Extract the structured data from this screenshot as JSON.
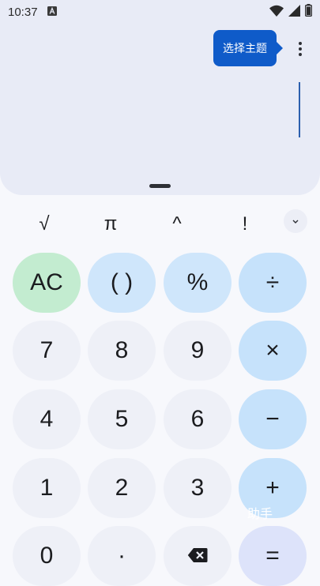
{
  "status_bar": {
    "time": "10:37",
    "notification_icon": "a-square-icon",
    "icons": [
      "wifi-icon",
      "signal-icon",
      "battery-icon"
    ]
  },
  "display": {
    "tooltip": "选择主题",
    "menu_icon": "more-vert-icon"
  },
  "scientific_row": {
    "keys": [
      "√",
      "π",
      "^",
      "!"
    ],
    "expand_icon": "chevron-down-icon"
  },
  "keypad": {
    "ac": "AC",
    "parens": "( )",
    "percent": "%",
    "divide": "÷",
    "seven": "7",
    "eight": "8",
    "nine": "9",
    "multiply": "×",
    "four": "4",
    "five": "5",
    "six": "6",
    "minus": "−",
    "one": "1",
    "two": "2",
    "three": "3",
    "plus": "+",
    "zero": "0",
    "decimal": "·",
    "backspace_icon": "backspace-icon",
    "equals": "="
  },
  "watermark": "助手",
  "colors": {
    "accent": "#0f5bc9",
    "ac_key": "#c3ecd0",
    "operator_key": "#c6e2fb",
    "digit_key": "#eef0f7",
    "display_bg": "#e8ebf6"
  }
}
